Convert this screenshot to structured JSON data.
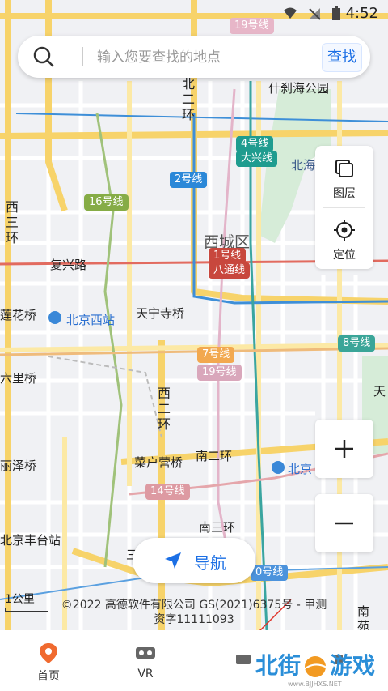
{
  "status": {
    "time": "4:52"
  },
  "search": {
    "placeholder": "输入您要查找的地点",
    "button": "查找"
  },
  "panel": {
    "layers": "图层",
    "locate": "定位"
  },
  "zoom": {
    "in": "+",
    "out": "−"
  },
  "navigation": {
    "label": "导航"
  },
  "map": {
    "labels": {
      "shichahai": "什刹海公园",
      "beihai": "北海",
      "xicheng": "西城区",
      "fuxinglu": "复兴路",
      "beijing_west": "北京西站",
      "tianningsi": "天宁寺桥",
      "lianhuaqiao": "莲花桥",
      "liuliqiao": "六里桥",
      "lizeqiao": "丽泽桥",
      "caihuying": "菜户营桥",
      "south2ring": "南二环",
      "south3ring": "南三环",
      "beijing_south": "北京",
      "fengtai": "北京丰台站",
      "tian": "天",
      "nan": "南",
      "yuan": "苑",
      "san": "三",
      "north2ring": "北二环",
      "west3ring": "西三环",
      "west2ring": "西二环"
    },
    "lines": {
      "l19_top": "19号线",
      "l4": "4号线",
      "daxing": "大兴线",
      "l2": "2号线",
      "l16": "16号线",
      "l1": "1号线",
      "batong": "八通线",
      "l7": "7号线",
      "l19_mid": "19号线",
      "l8": "8号线",
      "l14": "14号线",
      "l10": "0号线"
    },
    "scale": "1公里",
    "copyright_line1": "©2022 高德软件有限公司 GS(2021)6375号 - 甲测",
    "copyright_line2": "资字11111093"
  },
  "tabs": [
    {
      "label": "首页"
    },
    {
      "label": "VR"
    }
  ],
  "watermark": {
    "text1": "北街",
    "text2": "游戏",
    "url": "www.BJJHXS.NET"
  },
  "colors": {
    "accent": "#1b6fe5",
    "line2": "#2a87d6",
    "line1": "#c23a30",
    "line4": "#139a8a",
    "line16": "#7fa63d",
    "line7": "#e0a050",
    "line8": "#3ba39a",
    "line19": "#d9a7bb",
    "line14": "#d99aa0"
  }
}
